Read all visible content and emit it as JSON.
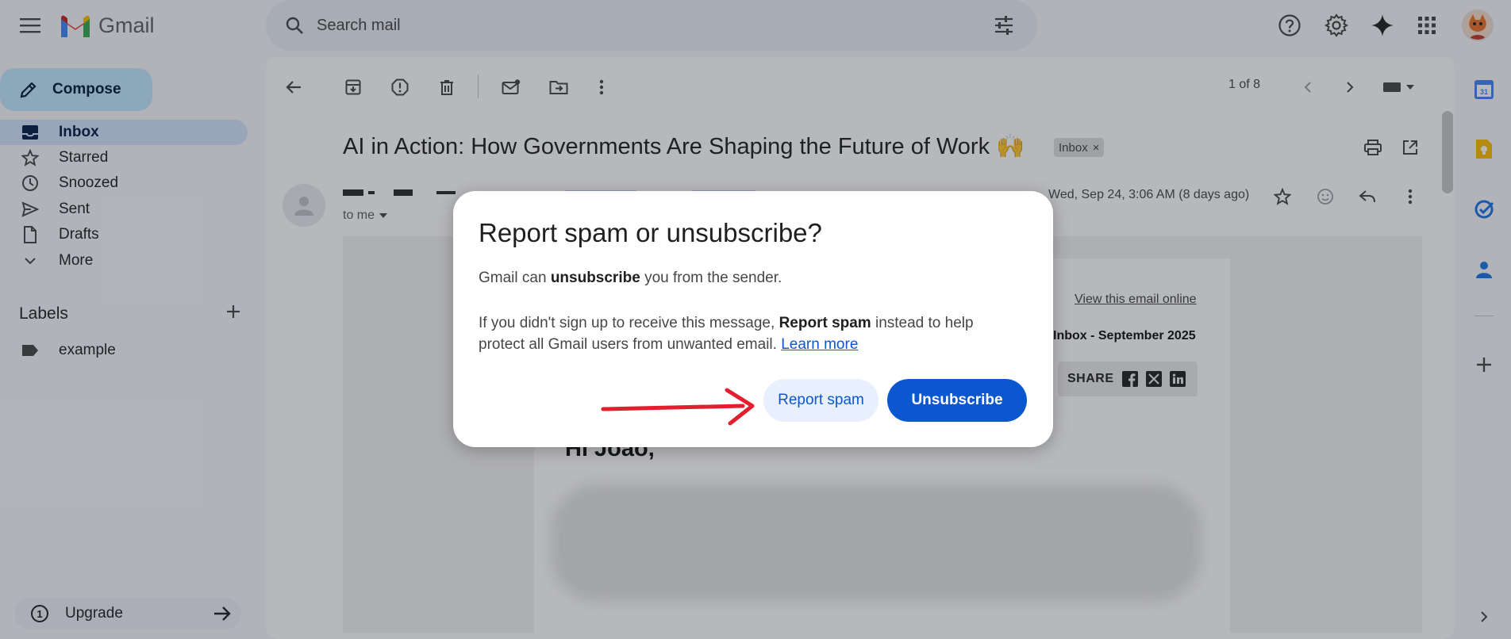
{
  "app": {
    "name": "Gmail"
  },
  "search": {
    "placeholder": "Search mail"
  },
  "nav": {
    "compose_label": "Compose",
    "items": [
      {
        "label": "Inbox",
        "icon": "inbox-icon",
        "active": true
      },
      {
        "label": "Starred",
        "icon": "star-icon"
      },
      {
        "label": "Snoozed",
        "icon": "clock-icon"
      },
      {
        "label": "Sent",
        "icon": "send-icon"
      },
      {
        "label": "Drafts",
        "icon": "draft-icon"
      },
      {
        "label": "More",
        "icon": "chevron-down-icon"
      }
    ],
    "labels_header": "Labels",
    "labels": [
      {
        "label": "example",
        "icon": "label-icon"
      }
    ],
    "upgrade_label": "Upgrade",
    "upgrade_badge": "1"
  },
  "toolbar": {
    "pager": "1 of 8"
  },
  "message": {
    "subject": "AI in Action: How Governments Are Shaping the Future of Work 🙌",
    "chip_label": "Inbox",
    "to_me": "to me",
    "date": "Wed, Sep 24, 3:06 AM (8 days ago)",
    "view_online": "View this email online",
    "newsletter_header": "Inbox - September 2025",
    "share_label": "SHARE",
    "greeting": "Hi Joao,"
  },
  "dialog": {
    "title": "Report spam or unsubscribe?",
    "p1_pre": "Gmail can ",
    "p1_bold": "unsubscribe",
    "p1_post": " you from the sender.",
    "p2_pre": "If you didn't sign up to receive this message, ",
    "p2_bold": "Report spam",
    "p2_post": " instead to help protect all Gmail users from unwanted email. ",
    "learn_more": "Learn more",
    "report_spam_label": "Report spam",
    "unsubscribe_label": "Unsubscribe"
  },
  "colors": {
    "accent": "#0b57d0",
    "compose_bg": "#c2e7ff",
    "active_nav_bg": "#d3e3fd",
    "annotation_arrow": "#e0202e"
  }
}
